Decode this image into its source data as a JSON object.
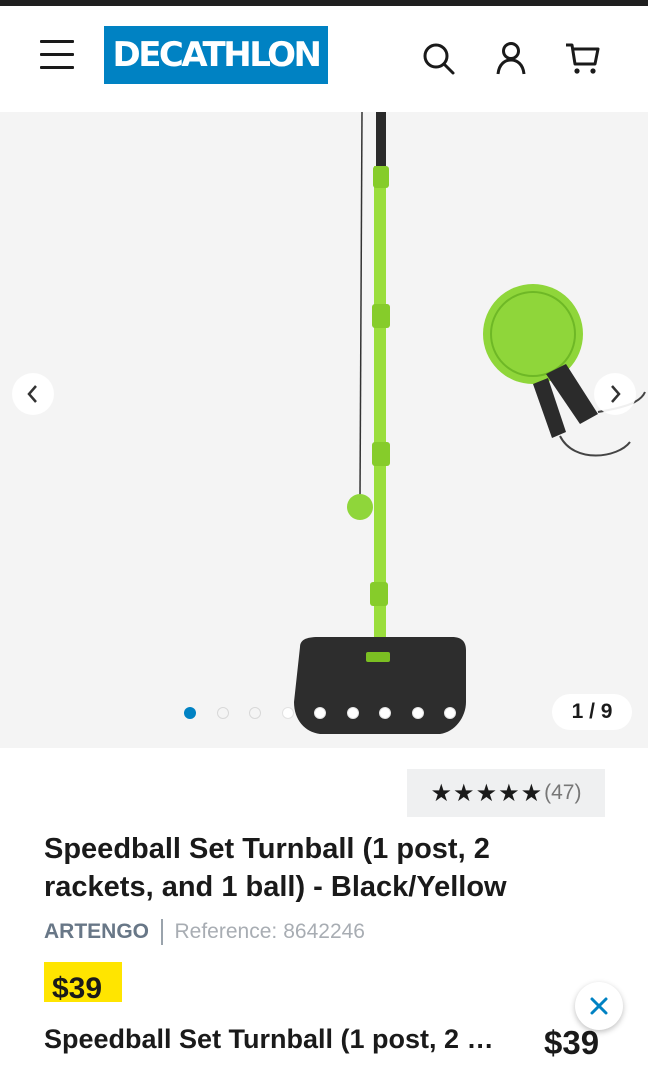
{
  "header": {
    "menu_icon": "hamburger-menu-icon",
    "logo_text": "DECATHLON",
    "search_icon": "search-icon",
    "account_icon": "user-icon",
    "cart_icon": "cart-icon",
    "brand_color": "#0082c3"
  },
  "gallery": {
    "counter": "1 / 9",
    "total_images": 9,
    "active_index": 1,
    "prev_icon": "chevron-left-icon",
    "next_icon": "chevron-right-icon"
  },
  "product": {
    "stars": "★★★★★",
    "rating_value": 5,
    "review_count": "(47)",
    "title": "Speedball Set Turnball (1 post, 2 rackets, and 1 ball) - Black/Yellow",
    "brand": "ARTENGO",
    "reference_label": "Reference:",
    "reference_value": "8642246",
    "price": "$39",
    "price_badge_color": "#ffe500"
  },
  "sticky_bar": {
    "title": "Speedball Set Turnball (1 post, 2 …",
    "price": "$39",
    "close_icon": "close-icon"
  }
}
